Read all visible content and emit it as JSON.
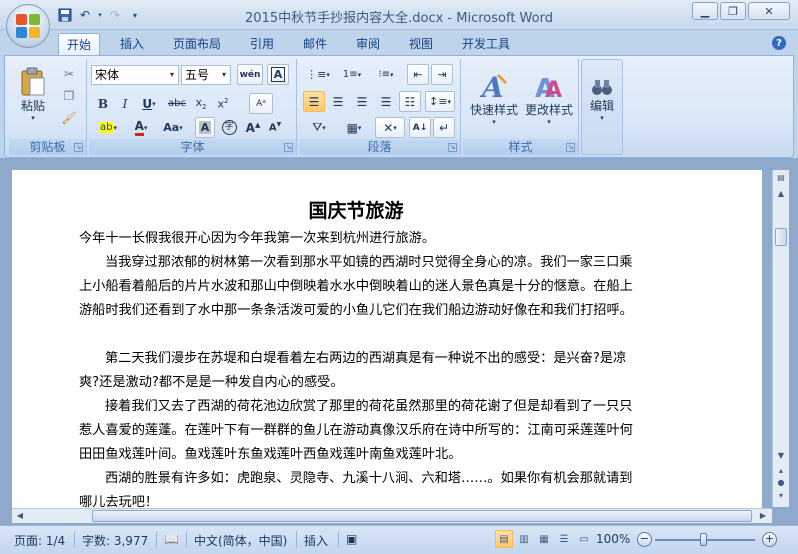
{
  "window": {
    "title": "2015中秋节手抄报内容大全.docx - Microsoft Word",
    "minimize_icon": "minimize-icon",
    "maximize_icon": "maximize-icon",
    "close_icon": "close-icon"
  },
  "tabs": [
    "开始",
    "插入",
    "页面布局",
    "引用",
    "邮件",
    "审阅",
    "视图",
    "开发工具"
  ],
  "ribbon": {
    "clipboard": {
      "paste_label": "粘贴",
      "group_label": "剪贴板"
    },
    "font": {
      "font_name": "宋体",
      "font_size": "五号",
      "group_label": "字体"
    },
    "paragraph": {
      "group_label": "段落"
    },
    "styles": {
      "quick_styles_label": "快速样式",
      "change_styles_label": "更改样式",
      "group_label": "样式"
    },
    "editing": {
      "label": "编辑"
    }
  },
  "document": {
    "title": "国庆节旅游",
    "paragraphs": [
      "今年十一长假我很开心因为今年我第一次来到杭州进行旅游。",
      "当我穿过那浓郁的树林第一次看到那水平如镜的西湖时只觉得全身心的凉。我们一家三口乘上小船看着船后的片片水波和那山中倒映着水水中倒映着山的迷人景色真是十分的惬意。在船上游船时我们还看到了水中那一条条活泼可爱的小鱼儿它们在我们船边游动好像在和我们打招呼。",
      "第二天我们漫步在苏堤和白堤看着左右两边的西湖真是有一种说不出的感受：是兴奋?是凉爽?还是激动?都不是是一种发自内心的感受。",
      "接着我们又去了西湖的荷花池边欣赏了那里的荷花虽然那里的荷花谢了但是却看到了一只只惹人喜爱的莲蓬。在莲叶下有一群群的鱼儿在游动真像汉乐府在诗中所写的：江南可采莲莲叶何田田鱼戏莲叶间。鱼戏莲叶东鱼戏莲叶西鱼戏莲叶南鱼戏莲叶北。",
      "西湖的胜景有许多如：虎跑泉、灵隐寺、九溪十八涧、六和塔……。如果你有机会那就请到哪儿去玩吧！"
    ]
  },
  "status": {
    "page": "页面: 1/4",
    "words": "字数: 3,977",
    "language": "中文(简体，中国)",
    "mode": "插入",
    "zoom": "100%",
    "zoom_minus": "−",
    "zoom_plus": "+"
  }
}
